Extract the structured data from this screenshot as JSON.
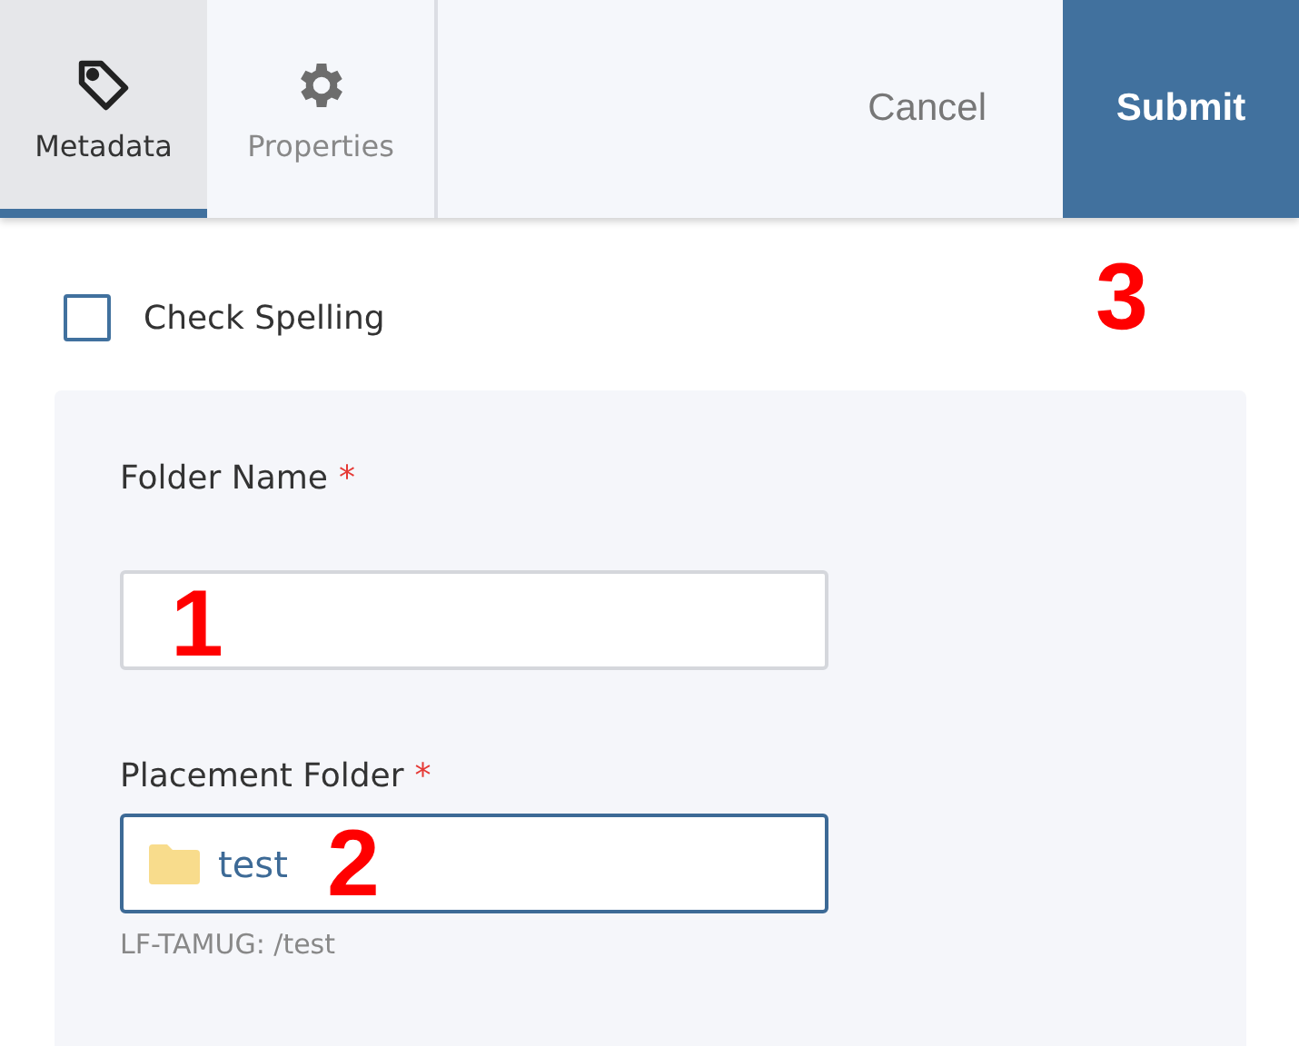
{
  "tabs": [
    {
      "label": "Metadata",
      "selected": true
    },
    {
      "label": "Properties",
      "selected": false
    }
  ],
  "actions": {
    "cancel": "Cancel",
    "submit": "Submit"
  },
  "check_spelling": {
    "label": "Check Spelling",
    "checked": false
  },
  "fields": [
    {
      "label": "Folder Name",
      "required_mark": "*",
      "focused": false
    },
    {
      "label": "Placement Folder",
      "required_mark": "*",
      "value": "test",
      "focused": true,
      "hint": "LF-TAMUG: /test"
    }
  ],
  "annotations": [
    "1",
    "2",
    "3"
  ]
}
